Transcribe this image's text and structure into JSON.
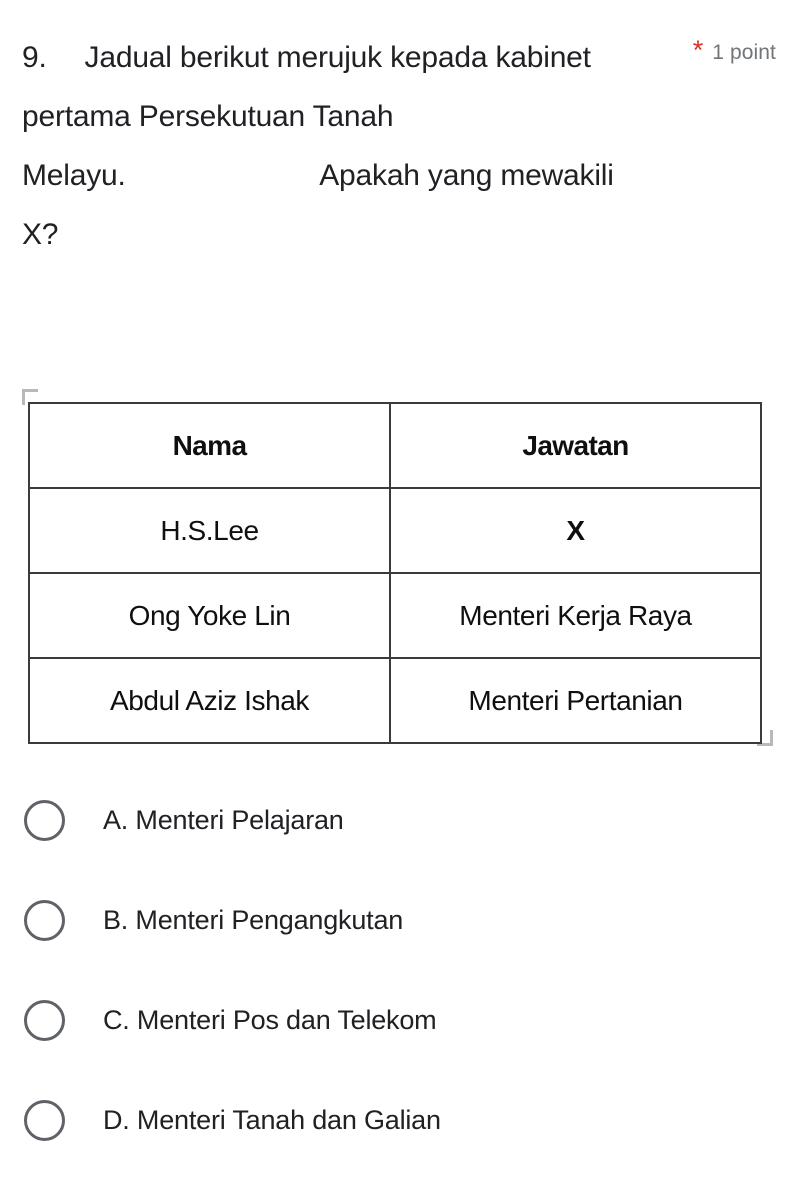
{
  "question": {
    "number": "9.",
    "text": "9.  Jadual berikut merujuk kepada kabinet pertama Persekutuan Tanah Melayu.       Apakah yang mewakili X?",
    "required_marker": "*",
    "points": "1 point",
    "required_color": "#d93025",
    "points_color": "#70757a"
  },
  "figure": {
    "name": "cabinet-table-image",
    "table": {
      "headers": [
        "Nama",
        "Jawatan"
      ],
      "rows": [
        [
          "H.S.Lee",
          "X"
        ],
        [
          "Ong Yoke Lin",
          "Menteri Kerja Raya"
        ],
        [
          "Abdul Aziz Ishak",
          "Menteri Pertanian"
        ]
      ]
    }
  },
  "options": [
    {
      "id": "A",
      "label": "A. Menteri Pelajaran",
      "selected": false
    },
    {
      "id": "B",
      "label": "B. Menteri Pengangkutan",
      "selected": false
    },
    {
      "id": "C",
      "label": "C. Menteri Pos dan Telekom",
      "selected": false
    },
    {
      "id": "D",
      "label": "D. Menteri Tanah dan Galian",
      "selected": false
    }
  ]
}
